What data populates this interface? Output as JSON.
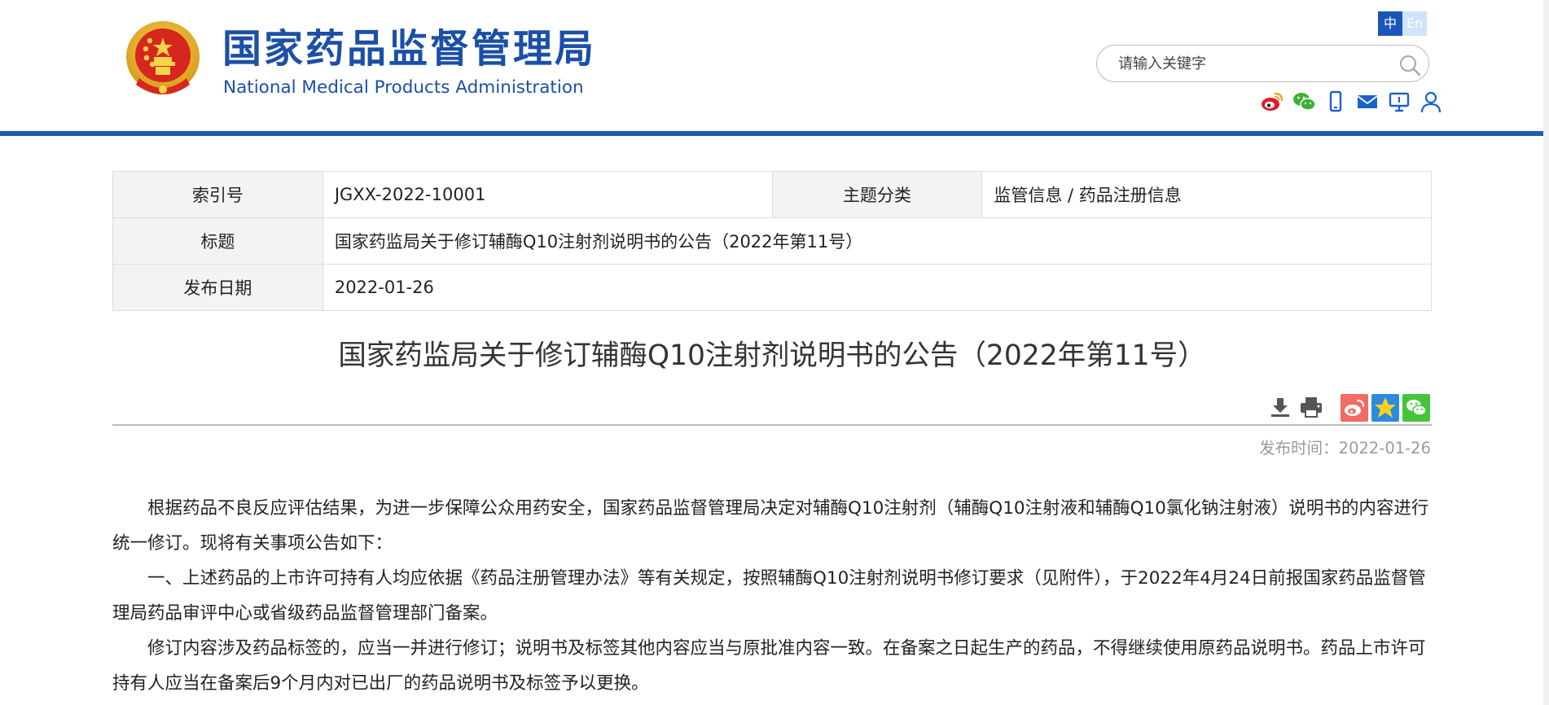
{
  "site": {
    "title": "国家药品监督管理局",
    "subtitle": "National Medical Products Administration"
  },
  "lang": {
    "zh": "中",
    "en": "En"
  },
  "search": {
    "placeholder": "请输入关键字"
  },
  "social_icons": [
    "weibo-icon",
    "wechat-icon",
    "mobile-icon",
    "mail-icon",
    "monitor-icon",
    "user-icon"
  ],
  "meta": {
    "index_label": "索引号",
    "index_value": "JGXX-2022-10001",
    "category_label": "主题分类",
    "category_value": "监管信息 / 药品注册信息",
    "title_label": "标题",
    "title_value": "国家药监局关于修订辅酶Q10注射剂说明书的公告（2022年第11号）",
    "date_label": "发布日期",
    "date_value": "2022-01-26"
  },
  "article": {
    "title": "国家药监局关于修订辅酶Q10注射剂说明书的公告（2022年第11号）",
    "pubtime": "发布时间：2022-01-26",
    "paragraphs": [
      "根据药品不良反应评估结果，为进一步保障公众用药安全，国家药品监督管理局决定对辅酶Q10注射剂（辅酶Q10注射液和辅酶Q10氯化钠注射液）说明书的内容进行统一修订。现将有关事项公告如下：",
      "一、上述药品的上市许可持有人均应依据《药品注册管理办法》等有关规定，按照辅酶Q10注射剂说明书修订要求（见附件），于2022年4月24日前报国家药品监督管理局药品审评中心或省级药品监督管理部门备案。",
      "修订内容涉及药品标签的，应当一并进行修订；说明书及标签其他内容应当与原批准内容一致。在备案之日起生产的药品，不得继续使用原药品说明书。药品上市许可持有人应当在备案后9个月内对已出厂的药品说明书及标签予以更换。"
    ]
  },
  "colors": {
    "brand_blue": "#1b4fa8",
    "header_bar": "#2359b2",
    "weibo_red": "#f26b64",
    "qzone_blue": "#2c8be0",
    "wechat_green": "#45c43b"
  }
}
